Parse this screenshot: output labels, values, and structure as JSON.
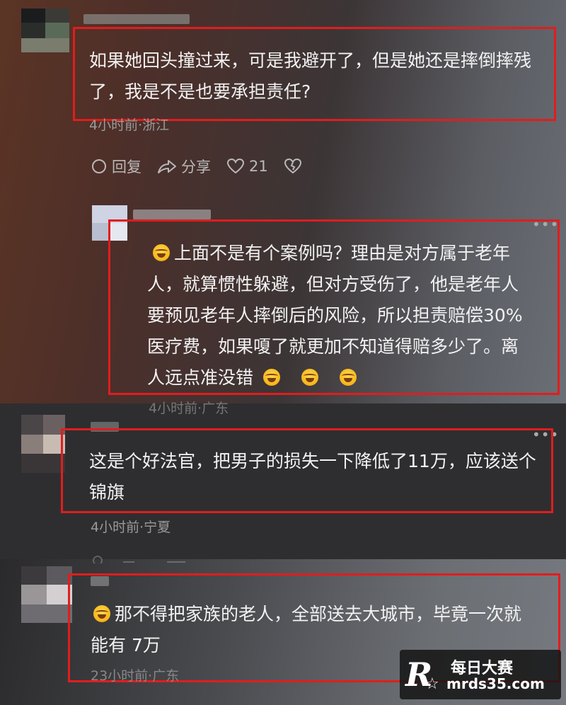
{
  "comment1": {
    "text": "如果她回头撞过来，可是我避开了，但是她还是摔倒摔残了，我是不是也要承担责任?",
    "meta": "4小时前·浙江",
    "reply_label": "回复",
    "share_label": "分享",
    "like_count": "21"
  },
  "reply1": {
    "text_line1": "上面不是有个案例吗？理由是对方属于老年",
    "text_line2": "人，就算惯性躲避，但对方受伤了，他是老年人",
    "text_line3": "要预见老年人摔倒后的风险，所以担责赔偿30%",
    "text_line4": "医疗费，如果嗄了就更加不知道得赔多少了。离",
    "text_line5": "人远点准没错",
    "meta": "4小时前·广东"
  },
  "comment2": {
    "text_line1": "这是个好法官，把男子的损失一下降低了11万，应该送个",
    "text_line2": "锦旗",
    "meta": "4小时前·宁夏"
  },
  "reply2": {
    "text_line1": "那不得把家族的老人，全部送去大城市，毕竟一次就",
    "text_line2": "能有 7万",
    "meta": "23小时前·广东"
  },
  "watermark": {
    "logo_letter": "R",
    "name": "每日大赛",
    "url": "mrds35.com"
  },
  "colors": {
    "highlight_border": "#e11d1d",
    "emoji": "#f6b51a"
  },
  "icons": [
    "comment-icon",
    "share-icon",
    "heart-icon",
    "broken-heart-icon",
    "more-icon",
    "laughing-tears-emoji"
  ]
}
